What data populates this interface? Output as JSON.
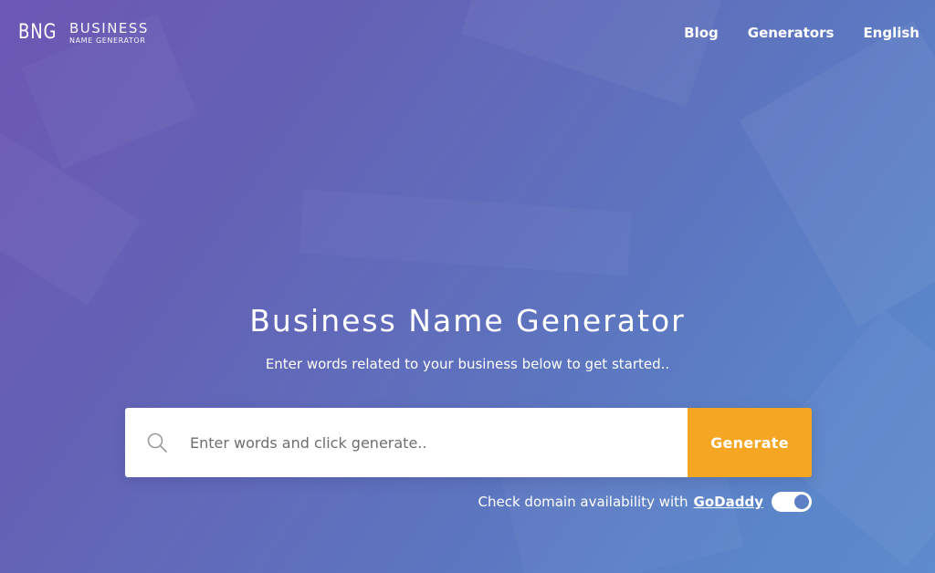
{
  "colors": {
    "background_start": "#6c57b4",
    "background_end": "#5e8bcc",
    "accent": "#f5a623",
    "text": "#ffffff",
    "toggle_knob": "#5d7fc6"
  },
  "header": {
    "logo": {
      "mark": "BNG",
      "line1": "BUSINESS",
      "line2": "NAME GENERATOR"
    },
    "nav": [
      {
        "label": "Blog"
      },
      {
        "label": "Generators"
      },
      {
        "label": "English"
      }
    ]
  },
  "hero": {
    "title": "Business Name Generator",
    "subtitle": "Enter words related to your business below to get started.."
  },
  "search": {
    "icon": "search-icon",
    "value": "",
    "placeholder": "Enter words and click generate..",
    "button_label": "Generate"
  },
  "domain_check": {
    "label": "Check domain availability with",
    "provider": "GoDaddy",
    "enabled": true
  }
}
